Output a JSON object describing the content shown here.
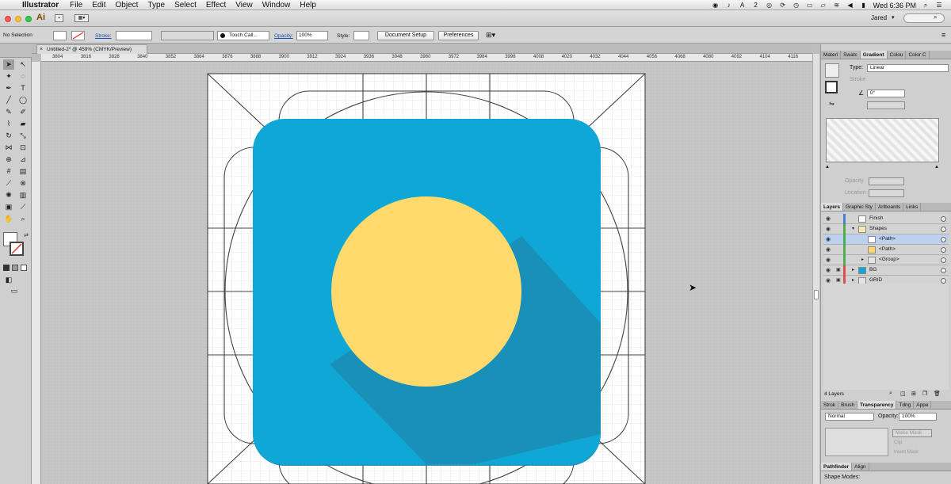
{
  "menubar": {
    "app_name": "Illustrator",
    "items": [
      "File",
      "Edit",
      "Object",
      "Type",
      "Select",
      "Effect",
      "View",
      "Window",
      "Help"
    ],
    "notif_count": "2",
    "clock": "Wed 6:36 PM"
  },
  "appbar": {
    "logo": "Ai",
    "user": "Jared",
    "user_arrow": "▾"
  },
  "control": {
    "selection_status": "No Selection",
    "stroke_label": "Stroke:",
    "brush_name": "Touch Call...",
    "opacity_label": "Opacity:",
    "opacity_value": "100%",
    "style_label": "Style:",
    "document_setup": "Document Setup",
    "preferences": "Preferences"
  },
  "document": {
    "tab_title": "Untitled-2* @ 459% (CMYK/Preview)",
    "ruler_ticks": [
      "3804",
      "3816",
      "3828",
      "3840",
      "3852",
      "3864",
      "3876",
      "3888",
      "3900",
      "3912",
      "3924",
      "3936",
      "3948",
      "3960",
      "3972",
      "3984",
      "3996",
      "4008",
      "4020",
      "4032",
      "4044",
      "4056",
      "4068",
      "4080",
      "4092",
      "4104",
      "4116"
    ]
  },
  "artwork": {
    "background_color": "#0fa7d5",
    "circle_color": "#ffd96b",
    "shadow_color": "#1990b8"
  },
  "gradient_panel": {
    "tabs": [
      "Materi",
      "Swatc",
      "Gradient",
      "Colou",
      "Color C"
    ],
    "active_tab": "Gradient",
    "type_label": "Type:",
    "type_value": "Linear",
    "stroke_label": "Stroke",
    "angle_value": "0°",
    "opacity_label": "Opacity",
    "location_label": "Location"
  },
  "layers_panel": {
    "tabs": [
      "Layers",
      "Graphic Sty",
      "Artboards",
      "Links"
    ],
    "active_tab": "Layers",
    "footer_count": "4 Layers",
    "rows": [
      {
        "name": "Finish",
        "color": "#4f7bd9",
        "thumb": "#ffffff",
        "locked": false,
        "expanded": "",
        "indent": 0,
        "selected": false
      },
      {
        "name": "Shapes",
        "color": "#4fae4f",
        "thumb": "#f6e7b3",
        "locked": false,
        "expanded": "▾",
        "indent": 0,
        "selected": false
      },
      {
        "name": "<Path>",
        "color": "#4fae4f",
        "thumb": "#ffffff",
        "locked": false,
        "expanded": "",
        "indent": 1,
        "selected": true
      },
      {
        "name": "<Path>",
        "color": "#4fae4f",
        "thumb": "#ffd96b",
        "locked": false,
        "expanded": "",
        "indent": 1,
        "selected": false
      },
      {
        "name": "<Group>",
        "color": "#4fae4f",
        "thumb": "#e4e4e4",
        "locked": false,
        "expanded": "▸",
        "indent": 1,
        "selected": false
      },
      {
        "name": "BG",
        "color": "#d94f4f",
        "thumb": "#0fa7d5",
        "locked": true,
        "expanded": "▸",
        "indent": 0,
        "selected": false
      },
      {
        "name": "GRID",
        "color": "#d94f4f",
        "thumb": "#e4e4e4",
        "locked": true,
        "expanded": "▸",
        "indent": 0,
        "selected": false
      }
    ]
  },
  "transparency_panel": {
    "tabs": [
      "Strok",
      "Brush",
      "Transparency",
      "Tdng",
      "Appe"
    ],
    "active_tab": "Transparency",
    "blend_mode": "Normal",
    "opacity_label": "Opacity:",
    "opacity_value": "100%",
    "make_mask": "Make Mask",
    "clip": "Clip",
    "invert_mask": "Invert Mask"
  },
  "pathfinder_panel": {
    "tabs": [
      "Pathfinder",
      "Align"
    ],
    "active_tab": "Pathfinder",
    "shape_modes_label": "Shape Modes:"
  }
}
